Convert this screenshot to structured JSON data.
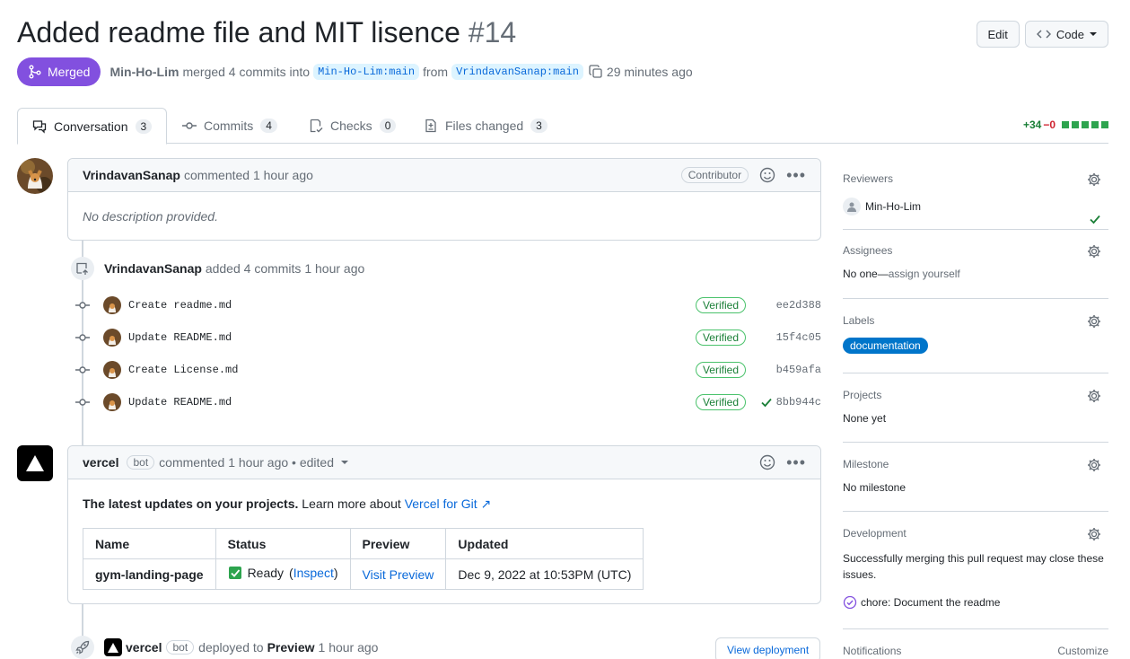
{
  "pr": {
    "title": "Added readme file and MIT lisence",
    "number": "#14",
    "state": "Merged",
    "merger": "Min-Ho-Lim",
    "merge_text": "merged 4 commits into",
    "base_branch": "Min-Ho-Lim:main",
    "from_text": "from",
    "head_branch": "VrindavanSanap:main",
    "time": "29 minutes ago"
  },
  "header_buttons": {
    "edit": "Edit",
    "code": "Code"
  },
  "tabs": [
    {
      "label": "Conversation",
      "count": "3"
    },
    {
      "label": "Commits",
      "count": "4"
    },
    {
      "label": "Checks",
      "count": "0"
    },
    {
      "label": "Files changed",
      "count": "3"
    }
  ],
  "diffstat": {
    "additions": "+34",
    "deletions": "−0"
  },
  "first_comment": {
    "author": "VrindavanSanap",
    "action": "commented 1 hour ago",
    "role": "Contributor",
    "body": "No description provided."
  },
  "commits_event": {
    "author": "VrindavanSanap",
    "action": "added 4 commits 1 hour ago",
    "commits": [
      {
        "message": "Create readme.md",
        "status": "Verified",
        "sha": "ee2d388"
      },
      {
        "message": "Update README.md",
        "status": "Verified",
        "sha": "15f4c05"
      },
      {
        "message": "Create License.md",
        "status": "Verified",
        "sha": "b459afa"
      },
      {
        "message": "Update README.md",
        "status": "Verified",
        "sha": "8bb944c"
      }
    ]
  },
  "bot_comment": {
    "author": "vercel",
    "bot_label": "bot",
    "action": "commented 1 hour ago • edited",
    "intro_bold": "The latest updates on your projects.",
    "intro_rest": "Learn more about",
    "intro_link": "Vercel for Git ↗",
    "table": {
      "headers": [
        "Name",
        "Status",
        "Preview",
        "Updated"
      ],
      "row": {
        "name": "gym-landing-page",
        "status": "Ready",
        "inspect": "Inspect",
        "preview": "Visit Preview",
        "updated": "Dec 9, 2022 at 10:53PM (UTC)"
      }
    }
  },
  "deploy_event": {
    "author": "vercel",
    "bot_label": "bot",
    "action": "deployed to",
    "env": "Preview",
    "time": "1 hour ago",
    "button": "View deployment"
  },
  "sidebar": {
    "reviewers": {
      "heading": "Reviewers",
      "name": "Min-Ho-Lim"
    },
    "assignees": {
      "heading": "Assignees",
      "value": "No one—",
      "link": "assign yourself"
    },
    "labels": {
      "heading": "Labels",
      "label": "documentation",
      "color": "#0075ca"
    },
    "projects": {
      "heading": "Projects",
      "value": "None yet"
    },
    "milestone": {
      "heading": "Milestone",
      "value": "No milestone"
    },
    "development": {
      "heading": "Development",
      "text": "Successfully merging this pull request may close these issues.",
      "issue": "chore: Document the readme"
    },
    "notifications": {
      "heading": "Notifications",
      "action": "Customize"
    }
  },
  "colors": {
    "merged": "#8250df",
    "link": "#0969da",
    "verified": "#1a7f37",
    "added": "#2da44e"
  }
}
